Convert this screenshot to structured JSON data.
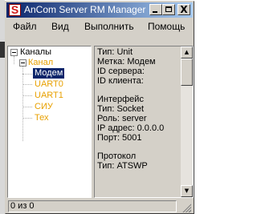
{
  "window": {
    "title": "AnCom Server RM Manager",
    "icon": "S",
    "buttons": {
      "minimize": "_",
      "maximize": "□",
      "close": "X"
    }
  },
  "menu": [
    "Файл",
    "Вид",
    "Выполнить",
    "Помощь"
  ],
  "tree": {
    "root": "Каналы",
    "group": "Канал",
    "selected": "Модем",
    "children": [
      "UART0",
      "UART1",
      "СИУ",
      "Тех"
    ]
  },
  "info": {
    "lines": [
      "Тип: Unit",
      "Метка: Модем",
      "ID сервера:",
      "ID клиента:",
      "",
      "Интерфейс",
      "Тип: Socket",
      "Роль: server",
      "IP адрес: 0.0.0.0",
      "Порт: 5001",
      "",
      "Протокол",
      "Тип: ATSWP"
    ]
  },
  "scrollbar": {
    "up_icon": "scroll-up-arrow-icon",
    "down_icon": "scroll-down-arrow-icon"
  },
  "status": {
    "text": "0 из 0"
  },
  "colors": {
    "title_start": "#0a246a",
    "title_end": "#a6caf0",
    "accent": "#e8a000",
    "selection": "#0a246a"
  }
}
